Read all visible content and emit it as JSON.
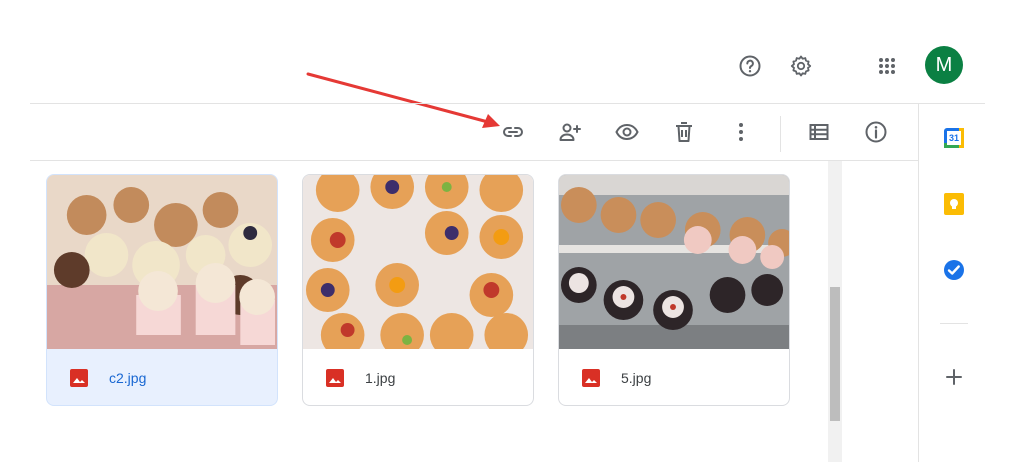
{
  "header": {
    "help_icon": "help-icon",
    "settings_icon": "gear-icon",
    "apps_icon": "apps-grid-icon",
    "avatar_letter": "M",
    "avatar_color": "#0b8043"
  },
  "toolbar": {
    "items": [
      "link-icon",
      "share-icon",
      "preview-icon",
      "delete-icon",
      "more-vert-icon",
      "list-view-icon",
      "info-icon"
    ]
  },
  "annotation": {
    "arrow_color": "#e53935"
  },
  "files": [
    {
      "name": "c2.jpg",
      "selected": true
    },
    {
      "name": "1.jpg",
      "selected": false
    },
    {
      "name": "5.jpg",
      "selected": false
    }
  ],
  "side_panel": {
    "calendar_label": "31",
    "items": [
      "calendar-icon",
      "keep-icon",
      "tasks-icon",
      "add-icon"
    ]
  },
  "colors": {
    "accent": "#1a73e8",
    "selected_bg": "#e8f0fe",
    "image_icon": "#d93025"
  }
}
